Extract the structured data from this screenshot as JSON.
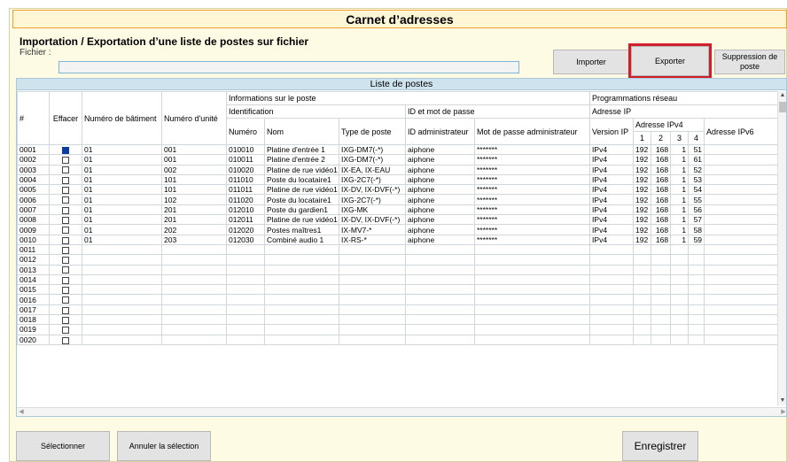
{
  "window": {
    "title": "Carnet d’adresses"
  },
  "transfer": {
    "section_title": "Importation / Exportation d’une liste de postes sur fichier",
    "file_label": "Fichier :",
    "file_value": "",
    "import_label": "Importer",
    "export_label": "Exporter",
    "delete_label": "Suppression de poste"
  },
  "list": {
    "title": "Liste de postes",
    "headers": {
      "num": "#",
      "delete": "Effacer",
      "building": "Numéro de bâtiment",
      "unit": "Numéro d'unité",
      "station_info": "Informations sur le poste",
      "identification": "Identification",
      "id_password": "ID et mot de passe",
      "network": "Programmations réseau",
      "ip_address": "Adresse IP",
      "number": "Numéro",
      "name": "Nom",
      "type": "Type de poste",
      "admin_id": "ID administrateur",
      "admin_password": "Mot de passe administrateur",
      "ip_version": "Version IP",
      "ipv4": "Adresse IPv4",
      "o1": "1",
      "o2": "2",
      "o3": "3",
      "o4": "4",
      "ipv6": "Adresse IPv6"
    },
    "rows": [
      {
        "n": "0001",
        "bld": "01",
        "unit": "001",
        "num": "010010",
        "name": "Platine d'entrée 1",
        "type": "IXG-DM7(-*)",
        "id": "aiphone",
        "pw": "*******",
        "ver": "IPv4",
        "o1": "192",
        "o2": "168",
        "o3": "1",
        "o4": "51",
        "v6": "",
        "sel": true
      },
      {
        "n": "0002",
        "bld": "01",
        "unit": "001",
        "num": "010011",
        "name": "Platine d'entrée 2",
        "type": "IXG-DM7(-*)",
        "id": "aiphone",
        "pw": "*******",
        "ver": "IPv4",
        "o1": "192",
        "o2": "168",
        "o3": "1",
        "o4": "61",
        "v6": ""
      },
      {
        "n": "0003",
        "bld": "01",
        "unit": "002",
        "num": "010020",
        "name": "Platine de rue vidéo1",
        "type": "IX-EA, IX-EAU",
        "id": "aiphone",
        "pw": "*******",
        "ver": "IPv4",
        "o1": "192",
        "o2": "168",
        "o3": "1",
        "o4": "52",
        "v6": ""
      },
      {
        "n": "0004",
        "bld": "01",
        "unit": "101",
        "num": "011010",
        "name": "Poste du locataire1",
        "type": "IXG-2C7(-*)",
        "id": "aiphone",
        "pw": "*******",
        "ver": "IPv4",
        "o1": "192",
        "o2": "168",
        "o3": "1",
        "o4": "53",
        "v6": ""
      },
      {
        "n": "0005",
        "bld": "01",
        "unit": "101",
        "num": "011011",
        "name": "Platine de rue vidéo1",
        "type": "IX-DV, IX-DVF(-*)",
        "id": "aiphone",
        "pw": "*******",
        "ver": "IPv4",
        "o1": "192",
        "o2": "168",
        "o3": "1",
        "o4": "54",
        "v6": ""
      },
      {
        "n": "0006",
        "bld": "01",
        "unit": "102",
        "num": "011020",
        "name": "Poste du locataire1",
        "type": "IXG-2C7(-*)",
        "id": "aiphone",
        "pw": "*******",
        "ver": "IPv4",
        "o1": "192",
        "o2": "168",
        "o3": "1",
        "o4": "55",
        "v6": ""
      },
      {
        "n": "0007",
        "bld": "01",
        "unit": "201",
        "num": "012010",
        "name": "Poste du gardien1",
        "type": "IXG-MK",
        "id": "aiphone",
        "pw": "*******",
        "ver": "IPv4",
        "o1": "192",
        "o2": "168",
        "o3": "1",
        "o4": "56",
        "v6": ""
      },
      {
        "n": "0008",
        "bld": "01",
        "unit": "201",
        "num": "012011",
        "name": "Platine de rue vidéo1",
        "type": "IX-DV, IX-DVF(-*)",
        "id": "aiphone",
        "pw": "*******",
        "ver": "IPv4",
        "o1": "192",
        "o2": "168",
        "o3": "1",
        "o4": "57",
        "v6": ""
      },
      {
        "n": "0009",
        "bld": "01",
        "unit": "202",
        "num": "012020",
        "name": "Postes maîtres1",
        "type": "IX-MV7-*",
        "id": "aiphone",
        "pw": "*******",
        "ver": "IPv4",
        "o1": "192",
        "o2": "168",
        "o3": "1",
        "o4": "58",
        "v6": ""
      },
      {
        "n": "0010",
        "bld": "01",
        "unit": "203",
        "num": "012030",
        "name": "Combiné audio 1",
        "type": "IX-RS-*",
        "id": "aiphone",
        "pw": "*******",
        "ver": "IPv4",
        "o1": "192",
        "o2": "168",
        "o3": "1",
        "o4": "59",
        "v6": ""
      },
      {
        "n": "0011"
      },
      {
        "n": "0012"
      },
      {
        "n": "0013"
      },
      {
        "n": "0014"
      },
      {
        "n": "0015"
      },
      {
        "n": "0016"
      },
      {
        "n": "0017"
      },
      {
        "n": "0018"
      },
      {
        "n": "0019"
      },
      {
        "n": "0020"
      }
    ]
  },
  "footer": {
    "select_label": "Sélectionner",
    "unselect_label": "Annuler la sélection",
    "save_label": "Enregistrer"
  },
  "colors": {
    "highlight": "#d21e2b",
    "checked": "#0a3d9e",
    "header_bg": "#cfe3ee"
  }
}
